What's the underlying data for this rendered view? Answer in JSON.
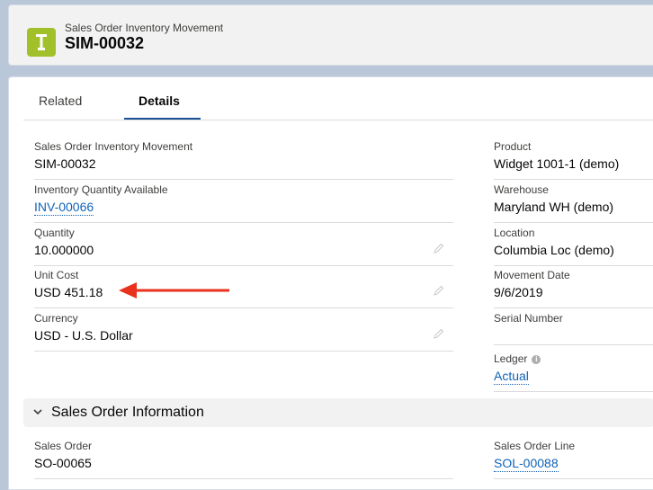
{
  "header": {
    "object_label": "Sales Order Inventory Movement",
    "record_name": "SIM-00032",
    "icon": "sales-order-inventory-icon",
    "icon_color": "#a2c02a"
  },
  "tabs": [
    {
      "label": "Related",
      "active": false
    },
    {
      "label": "Details",
      "active": true
    }
  ],
  "details": {
    "left": [
      {
        "label": "Sales Order Inventory Movement",
        "value": "SIM-00032",
        "link": false,
        "editable": false
      },
      {
        "label": "Inventory Quantity Available",
        "value": "INV-00066",
        "link": true,
        "editable": false
      },
      {
        "label": "Quantity",
        "value": "10.000000",
        "link": false,
        "editable": true
      },
      {
        "label": "Unit Cost",
        "value": "USD 451.18",
        "link": false,
        "editable": true
      },
      {
        "label": "Currency",
        "value": "USD - U.S. Dollar",
        "link": false,
        "editable": true
      }
    ],
    "right": [
      {
        "label": "Product",
        "value": "Widget 1001-1 (demo)",
        "link": false
      },
      {
        "label": "Warehouse",
        "value": "Maryland WH (demo)",
        "link": false
      },
      {
        "label": "Location",
        "value": "Columbia Loc (demo)",
        "link": false
      },
      {
        "label": "Movement Date",
        "value": "9/6/2019",
        "link": false
      },
      {
        "label": "Serial Number",
        "value": "",
        "link": false
      },
      {
        "label": "Ledger",
        "value": "Actual",
        "link": true,
        "info_icon": true
      }
    ]
  },
  "sales_order_section": {
    "title": "Sales Order Information",
    "expanded": true,
    "left": [
      {
        "label": "Sales Order",
        "value": "SO-00065",
        "link": false
      }
    ],
    "right": [
      {
        "label": "Sales Order Line",
        "value": "SOL-00088",
        "link": true
      }
    ]
  },
  "annotation": {
    "type": "arrow",
    "color": "#e8321e",
    "points_to": "Unit Cost"
  },
  "colors": {
    "link": "#1062b7",
    "tab_active_underline": "#1b5297"
  }
}
